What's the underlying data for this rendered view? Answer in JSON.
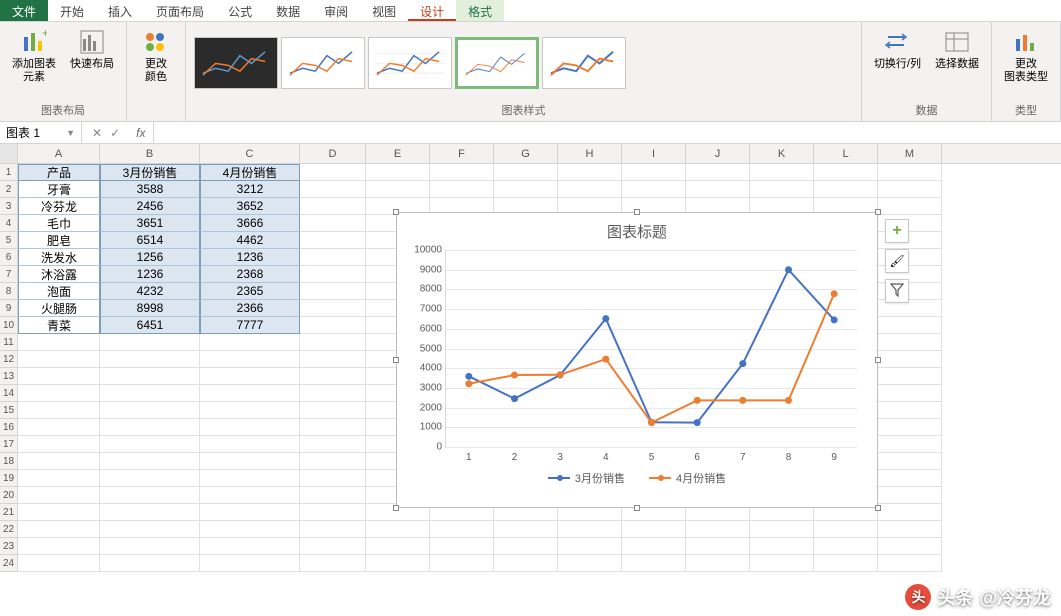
{
  "menu": {
    "file": "文件",
    "tabs": [
      "开始",
      "插入",
      "页面布局",
      "公式",
      "数据",
      "审阅",
      "视图"
    ],
    "context": [
      "设计",
      "格式"
    ]
  },
  "ribbon": {
    "layout_group": "图表布局",
    "add_element": "添加图表\n元素",
    "quick_layout": "快速布局",
    "change_color": "更改\n颜色",
    "styles_group": "图表样式",
    "switch_rowcol": "切换行/列",
    "select_data": "选择数据",
    "data_group": "数据",
    "change_type": "更改\n图表类型",
    "type_group": "类型"
  },
  "formula": {
    "namebox": "图表 1",
    "fx": "fx"
  },
  "columns": [
    "A",
    "B",
    "C",
    "D",
    "E",
    "F",
    "G",
    "H",
    "I",
    "J",
    "K",
    "L",
    "M"
  ],
  "table": {
    "headers": [
      "产品",
      "3月份销售",
      "4月份销售"
    ],
    "rows": [
      [
        "牙膏",
        "3588",
        "3212"
      ],
      [
        "冷芬龙",
        "2456",
        "3652"
      ],
      [
        "毛巾",
        "3651",
        "3666"
      ],
      [
        "肥皂",
        "6514",
        "4462"
      ],
      [
        "洗发水",
        "1256",
        "1236"
      ],
      [
        "沐浴露",
        "1236",
        "2368"
      ],
      [
        "泡面",
        "4232",
        "2365"
      ],
      [
        "火腿肠",
        "8998",
        "2366"
      ],
      [
        "青菜",
        "6451",
        "7777"
      ]
    ]
  },
  "chart_data": {
    "type": "line",
    "title": "图表标题",
    "x": [
      "1",
      "2",
      "3",
      "4",
      "5",
      "6",
      "7",
      "8",
      "9"
    ],
    "yticks": [
      0,
      1000,
      2000,
      3000,
      4000,
      5000,
      6000,
      7000,
      8000,
      9000,
      10000
    ],
    "ylim": [
      0,
      10000
    ],
    "series": [
      {
        "name": "3月份销售",
        "color": "#4472c4",
        "values": [
          3588,
          2456,
          3651,
          6514,
          1256,
          1236,
          4232,
          8998,
          6451
        ]
      },
      {
        "name": "4月份销售",
        "color": "#ed7d31",
        "values": [
          3212,
          3652,
          3666,
          4462,
          1236,
          2368,
          2365,
          2366,
          7777
        ]
      }
    ]
  },
  "watermark": {
    "prefix": "头条",
    "handle": "@冷芬龙"
  }
}
